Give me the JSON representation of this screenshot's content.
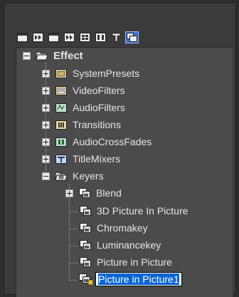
{
  "toolbar": {
    "buttons": [
      {
        "icon": "panel-icon"
      },
      {
        "icon": "arrows-icon"
      },
      {
        "icon": "panel-icon"
      },
      {
        "icon": "arrows-icon"
      },
      {
        "icon": "grid-icon"
      },
      {
        "icon": "grid-icon"
      },
      {
        "icon": "text-icon"
      },
      {
        "icon": "effect-icon",
        "selected": true
      }
    ]
  },
  "tree": {
    "root": {
      "label": "Effect",
      "expanded": true
    },
    "groups": [
      {
        "label": "SystemPresets",
        "icon": "folder-preset-icon"
      },
      {
        "label": "VideoFilters",
        "icon": "video-filter-icon"
      },
      {
        "label": "AudioFilters",
        "icon": "audio-filter-icon"
      },
      {
        "label": "Transitions",
        "icon": "transition-icon"
      },
      {
        "label": "AudioCrossFades",
        "icon": "audio-crossfade-icon"
      },
      {
        "label": "TitleMixers",
        "icon": "title-mixer-icon"
      },
      {
        "label": "Keyers",
        "icon": "keyer-folder-icon",
        "expanded": true
      }
    ],
    "keyers": {
      "items": [
        {
          "label": "Blend",
          "expandable": true
        },
        {
          "label": "3D Picture In Picture"
        },
        {
          "label": "Chromakey"
        },
        {
          "label": "Luminancekey"
        },
        {
          "label": "Picture in Picture"
        }
      ],
      "editing": {
        "value": "Picture in Picture1"
      }
    }
  },
  "colors": {
    "selection": "#0a64d2",
    "panel": "#4b4b4b"
  }
}
